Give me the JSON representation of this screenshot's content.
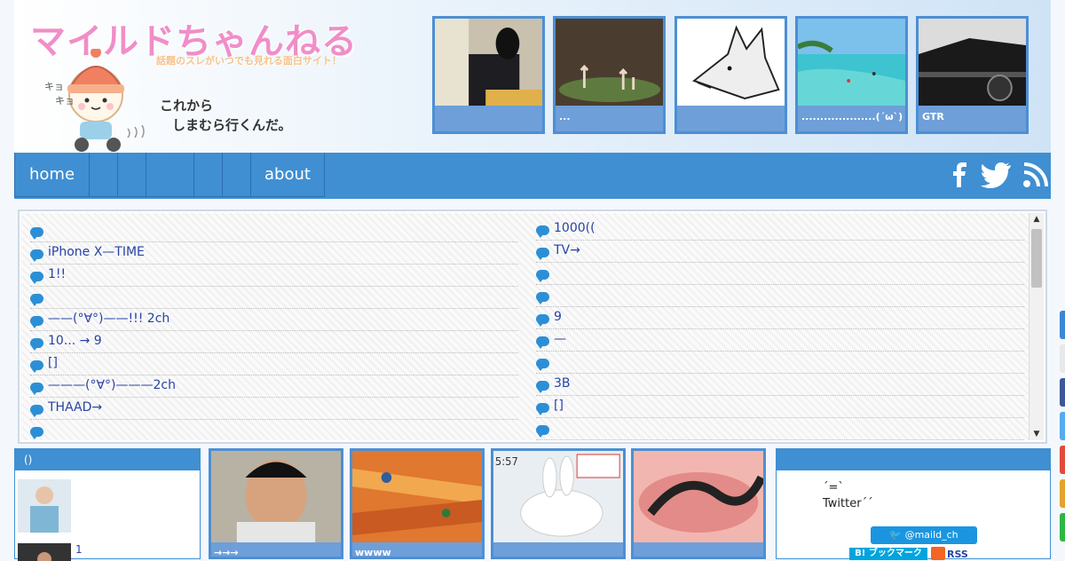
{
  "header": {
    "title": "マイルドちゃんねる",
    "subtitle": "話題のスレがいつでも見れる面白サイト！",
    "speech_line1": "これから",
    "speech_line2": "しまむら行くんだ。"
  },
  "featured": [
    {
      "caption": ""
    },
    {
      "caption": "..."
    },
    {
      "caption": ""
    },
    {
      "caption": "....................(´ω`)"
    },
    {
      "caption": "GTR"
    }
  ],
  "nav": {
    "items": [
      {
        "label": "home"
      },
      {
        "label": ""
      },
      {
        "label": ""
      },
      {
        "label": ""
      },
      {
        "label": ""
      },
      {
        "label": ""
      },
      {
        "label": "about"
      }
    ]
  },
  "news": {
    "left": [
      "",
      "iPhone X—TIME",
      "1!!",
      "",
      "——(°∀°)——!!! 2ch",
      "10... → 9",
      " []",
      "———(°∀°)———2ch",
      "THAAD→",
      ""
    ],
    "right": [
      "1000((",
      "TV→",
      "",
      "",
      "9",
      "—",
      "",
      "3B",
      " []",
      ""
    ]
  },
  "left_panel": {
    "heading": "()",
    "items": [
      "",
      "1"
    ]
  },
  "mid_thumbs": [
    {
      "caption": "→→→"
    },
    {
      "caption": "wwww"
    },
    {
      "caption": ""
    },
    {
      "caption": ""
    }
  ],
  "right_panel": {
    "heading": "",
    "line1": "´=`",
    "line2": "Twitter´´",
    "twitter_button": "@maild_ch",
    "hatena_button": "B! ブックマーク",
    "rss_label": "RSS"
  }
}
